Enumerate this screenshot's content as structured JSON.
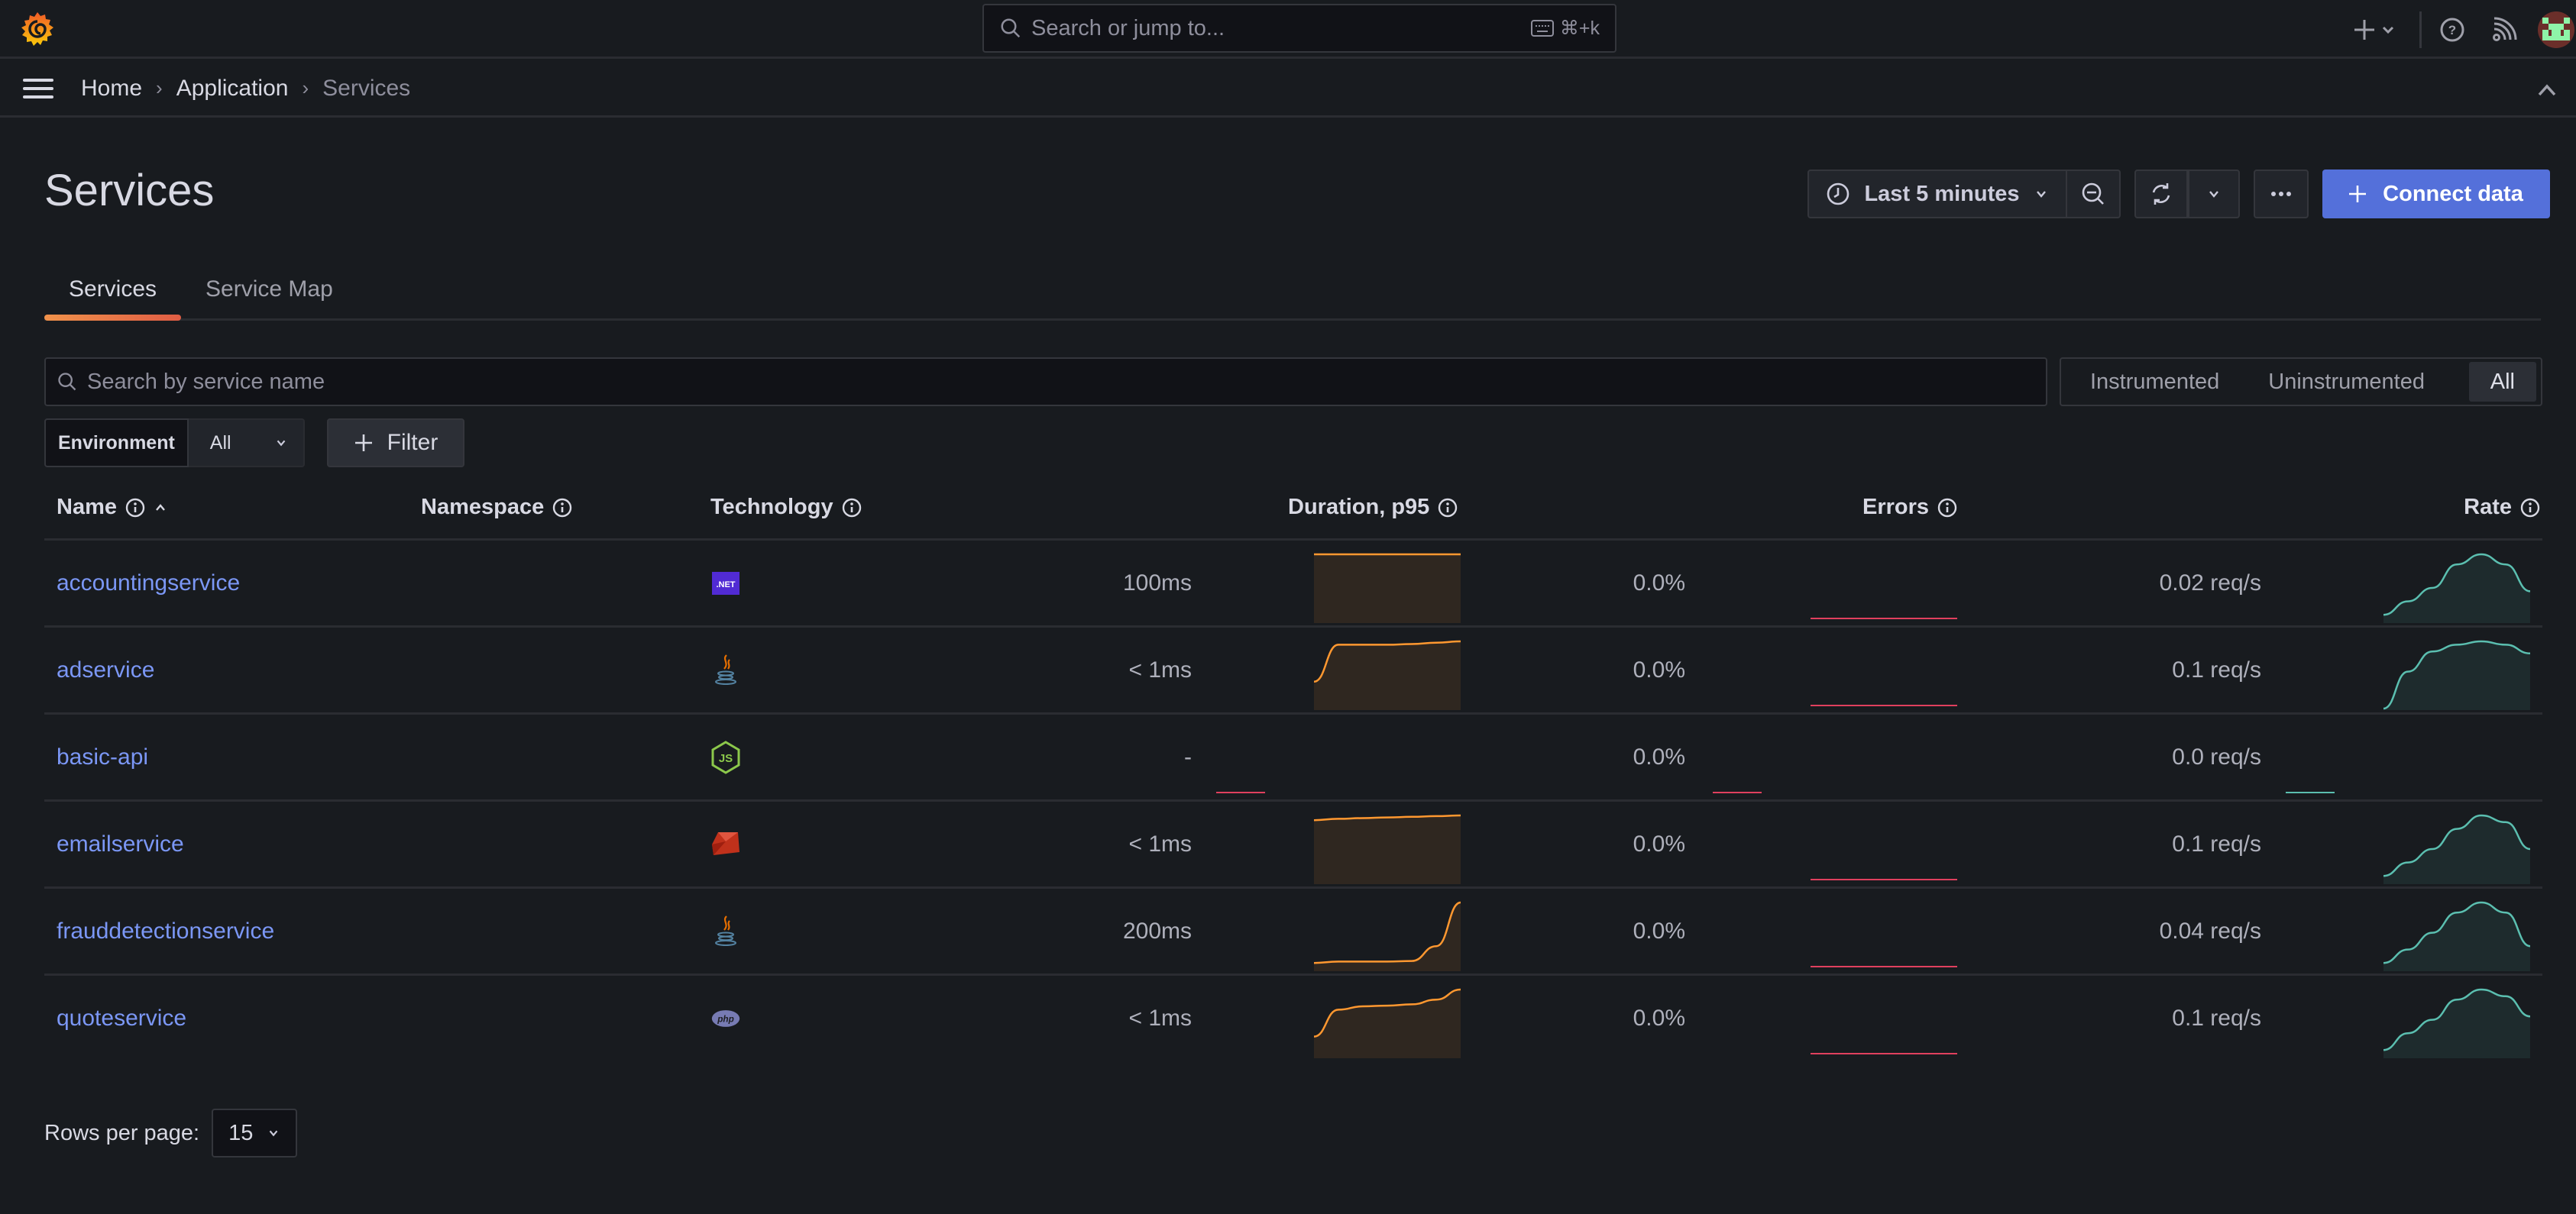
{
  "topbar": {
    "search_placeholder": "Search or jump to...",
    "shortcut": "⌘+k"
  },
  "breadcrumb": [
    "Home",
    "Application",
    "Services"
  ],
  "page": {
    "title": "Services",
    "time_range": "Last 5 minutes",
    "connect_label": "Connect data"
  },
  "tabs": [
    {
      "label": "Services",
      "active": true
    },
    {
      "label": "Service Map",
      "active": false
    }
  ],
  "search": {
    "placeholder": "Search by service name",
    "value": ""
  },
  "segmented": {
    "options": [
      "Instrumented",
      "Uninstrumented",
      "All"
    ],
    "selected": "All"
  },
  "environment": {
    "label": "Environment",
    "value": "All"
  },
  "filter_label": "Filter",
  "columns": {
    "name": "Name",
    "namespace": "Namespace",
    "technology": "Technology",
    "duration": "Duration, p95",
    "errors": "Errors",
    "rate": "Rate"
  },
  "sort": {
    "column": "name",
    "direction": "ascending"
  },
  "colors": {
    "duration": "#ff9830",
    "errors": "#e0405e",
    "rate": "#5bbfb0",
    "link": "#7b97f5",
    "primary": "#5470da"
  },
  "rows": [
    {
      "name": "accountingservice",
      "namespace": "",
      "technology": "dotnet",
      "duration": "100ms",
      "errors": "0.0%",
      "rate": "0.02 req/s",
      "duration_series": [
        1,
        1,
        1,
        1,
        1,
        1,
        1
      ],
      "error_series": [
        0,
        0,
        0,
        0,
        0,
        0,
        0
      ],
      "rate_series": [
        0.1,
        0.3,
        0.5,
        0.85,
        1,
        0.85,
        0.45
      ]
    },
    {
      "name": "adservice",
      "namespace": "",
      "technology": "java",
      "duration": "< 1ms",
      "errors": "0.0%",
      "rate": "0.1 req/s",
      "duration_series": [
        0.4,
        0.95,
        0.95,
        0.95,
        0.96,
        0.98,
        1
      ],
      "error_series": [
        0,
        0,
        0,
        0,
        0,
        0,
        0
      ],
      "rate_series": [
        0,
        0.55,
        0.85,
        0.95,
        1,
        0.95,
        0.82
      ]
    },
    {
      "name": "basic-api",
      "namespace": "",
      "technology": "nodejs",
      "duration": "-",
      "errors": "0.0%",
      "rate": "0.0 req/s",
      "duration_series": [
        0,
        0
      ],
      "error_series": [
        0,
        0
      ],
      "rate_series": [
        0,
        0
      ]
    },
    {
      "name": "emailservice",
      "namespace": "",
      "technology": "ruby",
      "duration": "< 1ms",
      "errors": "0.0%",
      "rate": "0.1 req/s",
      "duration_series": [
        0.93,
        0.95,
        0.96,
        0.97,
        0.98,
        0.99,
        1
      ],
      "error_series": [
        0,
        0,
        0,
        0,
        0,
        0,
        0
      ],
      "rate_series": [
        0.1,
        0.3,
        0.5,
        0.8,
        1,
        0.9,
        0.5
      ]
    },
    {
      "name": "frauddetectionservice",
      "namespace": "",
      "technology": "java",
      "duration": "200ms",
      "errors": "0.0%",
      "rate": "0.04 req/s",
      "duration_series": [
        0.1,
        0.12,
        0.12,
        0.12,
        0.13,
        0.35,
        1
      ],
      "error_series": [
        0,
        0,
        0,
        0,
        0,
        0,
        0
      ],
      "rate_series": [
        0.1,
        0.3,
        0.55,
        0.85,
        1,
        0.85,
        0.35
      ]
    },
    {
      "name": "quoteservice",
      "namespace": "",
      "technology": "php",
      "duration": "< 1ms",
      "errors": "0.0%",
      "rate": "0.1 req/s",
      "duration_series": [
        0.3,
        0.7,
        0.75,
        0.76,
        0.78,
        0.85,
        1
      ],
      "error_series": [
        0,
        0,
        0,
        0,
        0,
        0,
        0
      ],
      "rate_series": [
        0.1,
        0.35,
        0.55,
        0.85,
        1,
        0.9,
        0.6
      ]
    }
  ],
  "pagination": {
    "label": "Rows per page:",
    "value": "15"
  }
}
